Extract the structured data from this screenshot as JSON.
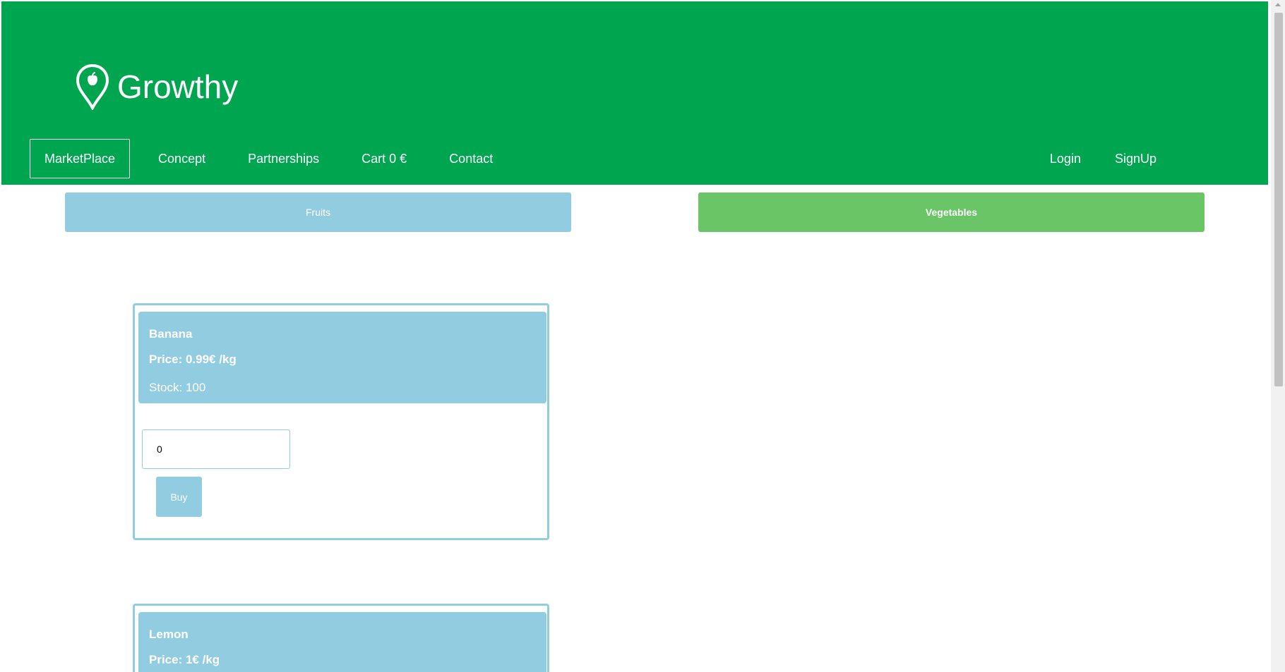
{
  "brand": {
    "name": "Growthy",
    "icon": "map-pin-apple-icon"
  },
  "nav": {
    "left": [
      {
        "label": "MarketPlace",
        "active": true
      },
      {
        "label": "Concept",
        "active": false
      },
      {
        "label": "Partnerships",
        "active": false
      },
      {
        "label": "Cart 0 €",
        "active": false
      },
      {
        "label": "Contact",
        "active": false
      }
    ],
    "right": [
      {
        "label": "Login"
      },
      {
        "label": "SignUp"
      }
    ]
  },
  "categories": {
    "fruits": "Fruits",
    "vegetables": "Vegetables"
  },
  "products": [
    {
      "name": "Banana",
      "price": "Price: 0.99€ /kg",
      "stock": "Stock: 100",
      "quantity": "0",
      "buy_label": "Buy"
    },
    {
      "name": "Lemon",
      "price": "Price: 1€ /kg"
    }
  ],
  "colors": {
    "header_green": "#00a64f",
    "light_blue": "#92cce0",
    "vegetables_green": "#6ac566",
    "white": "#ffffff"
  }
}
